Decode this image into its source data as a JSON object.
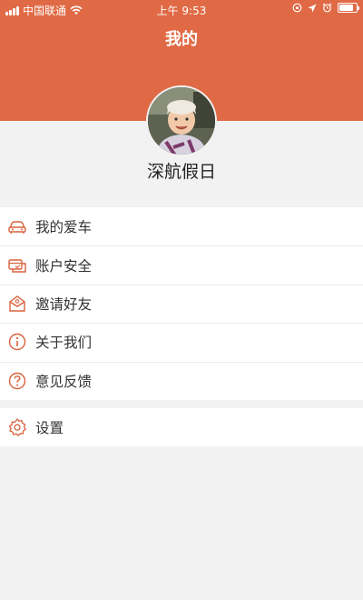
{
  "status_bar": {
    "carrier": "中国联通",
    "time": "上午 9:53",
    "battery_level": 0.85
  },
  "header": {
    "title": "我的",
    "background_color": "#e06a45"
  },
  "profile": {
    "avatar_icon": "user-photo-avatar",
    "username": "深航假日"
  },
  "menu": {
    "items": [
      {
        "label": "我的爱车",
        "icon": "car-icon"
      },
      {
        "label": "账户安全",
        "icon": "account-security-icon"
      },
      {
        "label": "邀请好友",
        "icon": "invite-friends-icon"
      },
      {
        "label": "关于我们",
        "icon": "info-icon"
      },
      {
        "label": "意见反馈",
        "icon": "question-icon"
      }
    ]
  },
  "settings": {
    "label": "设置",
    "icon": "gear-icon"
  },
  "colors": {
    "accent": "#e06a45",
    "icon": "#d9623c",
    "page_background": "#f2f2f2"
  }
}
